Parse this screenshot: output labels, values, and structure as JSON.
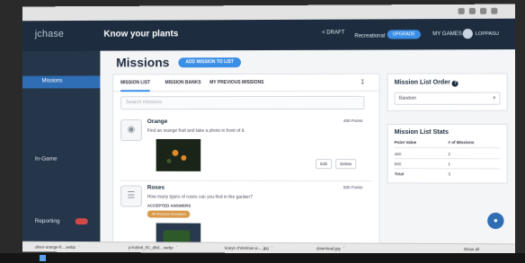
{
  "app": {
    "logo": "jchase",
    "tagline": "Know your plants",
    "draft": "< DRAFT",
    "recreational": "Recreational",
    "upgrade": "UPGRADE",
    "my_games": "MY GAMES",
    "user": "LOPPASU"
  },
  "sidebar": {
    "items": [
      {
        "label": "Missions"
      },
      {
        "label": "In-Game"
      },
      {
        "label": "Reporting",
        "badge": "NEW"
      }
    ]
  },
  "main": {
    "title": "Missions",
    "add_button": "ADD MISSION TO LIST",
    "tabs": [
      "MISSION LIST",
      "MISSION BANKS",
      "MY PREVIOUS MISSIONS"
    ],
    "search_placeholder": "Search missions",
    "missions": [
      {
        "title": "Orange",
        "points": "400 Points",
        "description": "Find an orange fruit and take a photo in front of it.",
        "edit": "Edit",
        "delete": "Delete"
      },
      {
        "title": "Roses",
        "points": "500 Points",
        "description": "How many types of roses can you find in the garden?",
        "accepted_label": "ACCEPTED ANSWERS",
        "all_accepted": "All Answers Accepted"
      }
    ]
  },
  "order_panel": {
    "title": "Mission List Order",
    "selected": "Random"
  },
  "stats_panel": {
    "title": "Mission List Stats",
    "headers": [
      "Point Value",
      "# of Missions"
    ],
    "rows": [
      {
        "value": "400",
        "count": "2"
      },
      {
        "value": "500",
        "count": "1"
      },
      {
        "value": "Total",
        "count": "3"
      }
    ]
  },
  "downloads": {
    "items": [
      "oliver-orange-fr....webp",
      "p-hobx8_0C_dbd....webp",
      "koeys christmas.w.....jpg",
      "download.jpg"
    ],
    "show_all": "Show all"
  }
}
